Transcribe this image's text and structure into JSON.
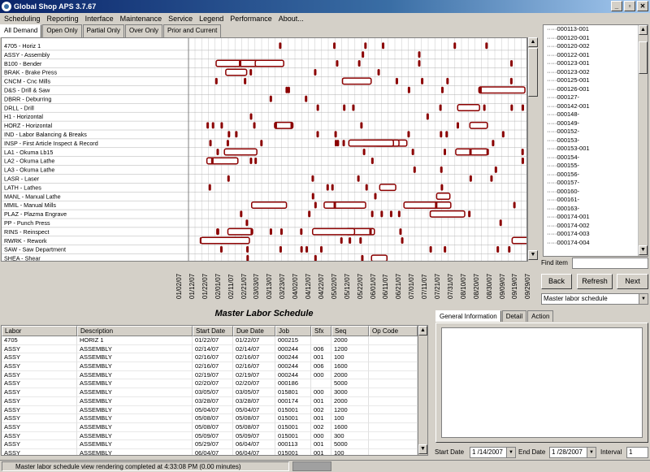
{
  "app": {
    "title": "Global Shop APS 3.7.67"
  },
  "window_buttons": {
    "min": "_",
    "max": "▫",
    "close": "✕"
  },
  "menu": [
    "Scheduling",
    "Reporting",
    "Interface",
    "Maintenance",
    "Service",
    "Legend",
    "Performance",
    "About..."
  ],
  "tabs": [
    "All Demand",
    "Open Only",
    "Partial Only",
    "Over Only",
    "Prior and Current"
  ],
  "resources": [
    "4705 - Horiz 1",
    "ASSY - Assembly",
    "B100 - Bender",
    "BRAK - Brake Press",
    "CNCM - Cnc Mills",
    "D&S - Drill & Saw",
    "DBRR - Deburring",
    "DRLL - Drill",
    "H1 - Horizontal",
    "HORZ - Horizontal",
    "IND - Labor Balancing & Breaks",
    "INSP - First Article Inspect & Record",
    "LA1 - Okuma Lb15",
    "LA2 - Okuma Lathe",
    "LA3 - Okuma Lathe",
    "LASR - Laser",
    "LATH - Lathes",
    "MANL - Manual Lathe",
    "MMIL - Manual Mills",
    "PLAZ - Plazma Engrave",
    "PP - Punch Press",
    "RINS - Reinspect",
    "RWRK - Rework",
    "SAW - Saw Department",
    "SHEA - Shear"
  ],
  "timeline_dates": [
    "01/02/07",
    "01/12/07",
    "01/22/07",
    "02/01/07",
    "02/11/07",
    "02/21/07",
    "03/03/07",
    "03/13/07",
    "03/23/07",
    "04/02/07",
    "04/12/07",
    "04/22/07",
    "05/02/07",
    "05/12/07",
    "05/22/07",
    "06/01/07",
    "06/11/07",
    "06/21/07",
    "07/01/07",
    "07/11/07",
    "07/21/07",
    "07/31/07",
    "08/10/07",
    "08/20/07",
    "08/30/07",
    "09/09/07",
    "09/19/07",
    "09/29/07"
  ],
  "item_list": [
    "000113-001",
    "000120-001",
    "000120-002",
    "000122-001",
    "000123-001",
    "000123-002",
    "000125-001",
    "000126-001",
    "000127-",
    "000142-001",
    "000148-",
    "000149-",
    "000152-",
    "000153-",
    "000153-001",
    "000154-",
    "000155-",
    "000156-",
    "000157-",
    "000160-",
    "000161-",
    "000163-",
    "000174-001",
    "000174-002",
    "000174-003",
    "000174-004"
  ],
  "find_item_label": "Find item",
  "nav_buttons": {
    "back": "Back",
    "refresh": "Refresh",
    "next": "Next"
  },
  "view_select": "Master labor schedule",
  "schedule_title": "Master Labor Schedule",
  "table": {
    "headers": [
      "Labor",
      "Description",
      "Start Date",
      "Due Date",
      "Job",
      "Sfx",
      "Seq",
      "Op Code"
    ],
    "rows": [
      [
        "4705",
        "HORIZ 1",
        "01/22/07",
        "01/22/07",
        "000215",
        "",
        "2000",
        ""
      ],
      [
        "ASSY",
        "ASSEMBLY",
        "02/14/07",
        "02/14/07",
        "000244",
        "006",
        "1200",
        ""
      ],
      [
        "ASSY",
        "ASSEMBLY",
        "02/16/07",
        "02/16/07",
        "000244",
        "001",
        "100",
        ""
      ],
      [
        "ASSY",
        "ASSEMBLY",
        "02/16/07",
        "02/16/07",
        "000244",
        "006",
        "1600",
        ""
      ],
      [
        "ASSY",
        "ASSEMBLY",
        "02/19/07",
        "02/19/07",
        "000244",
        "000",
        "2000",
        ""
      ],
      [
        "ASSY",
        "ASSEMBLY",
        "02/20/07",
        "02/20/07",
        "000186",
        "",
        "5000",
        ""
      ],
      [
        "ASSY",
        "ASSEMBLY",
        "03/05/07",
        "03/05/07",
        "015801",
        "000",
        "3000",
        ""
      ],
      [
        "ASSY",
        "ASSEMBLY",
        "03/28/07",
        "03/28/07",
        "000174",
        "001",
        "2000",
        ""
      ],
      [
        "ASSY",
        "ASSEMBLY",
        "05/04/07",
        "05/04/07",
        "015001",
        "002",
        "1200",
        ""
      ],
      [
        "ASSY",
        "ASSEMBLY",
        "05/08/07",
        "05/08/07",
        "015001",
        "001",
        "100",
        ""
      ],
      [
        "ASSY",
        "ASSEMBLY",
        "05/08/07",
        "05/08/07",
        "015001",
        "002",
        "1600",
        ""
      ],
      [
        "ASSY",
        "ASSEMBLY",
        "05/09/07",
        "05/09/07",
        "015001",
        "000",
        "300",
        ""
      ],
      [
        "ASSY",
        "ASSEMBLY",
        "05/29/07",
        "06/04/07",
        "000113",
        "001",
        "5000",
        ""
      ],
      [
        "ASSY",
        "ASSEMBLY",
        "06/04/07",
        "06/04/07",
        "015001",
        "001",
        "100",
        ""
      ]
    ]
  },
  "right_tabs": [
    "General Information",
    "Detail",
    "Action"
  ],
  "date_controls": {
    "start_label": "Start Date",
    "start_value": "1 /14/2007",
    "end_label": "End Date",
    "end_value": "1 /28/2007",
    "interval_label": "Interval",
    "interval_value": "1"
  },
  "status": {
    "message": "Master labor schedule view rendering completed at 4:33:08 PM  (0.00 minutes)"
  },
  "colors": {
    "bar_border": "#8b0000",
    "bar_fill": "#e07070",
    "title_start": "#0a246a"
  }
}
